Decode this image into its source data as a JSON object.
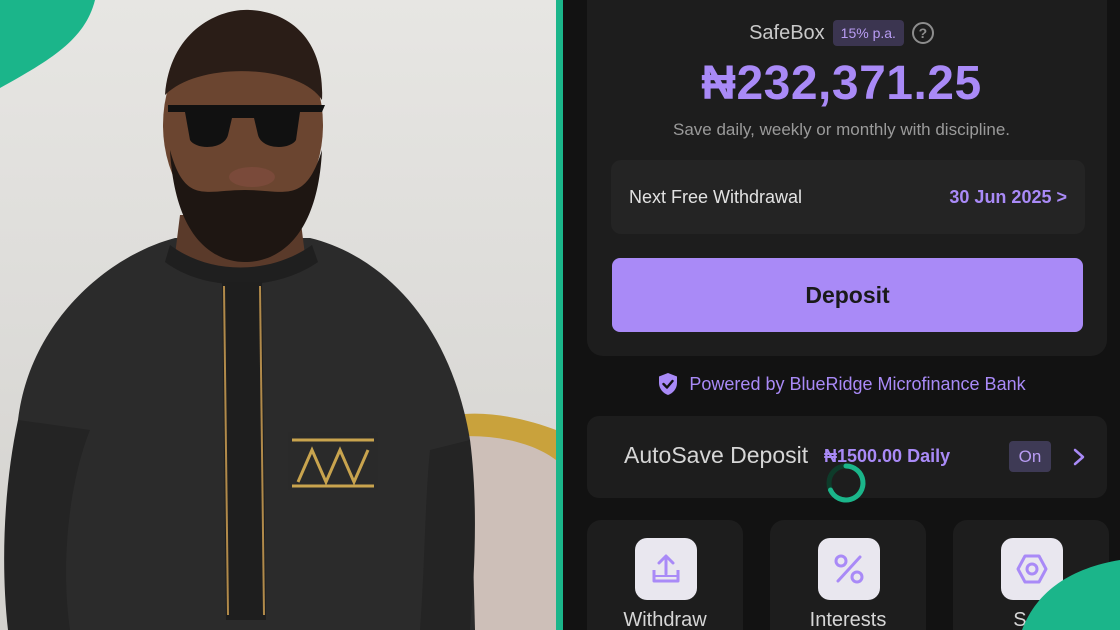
{
  "savings": {
    "title": "SafeBox",
    "rate_badge": "15% p.a.",
    "help_icon": "?",
    "balance": "₦232,371.25",
    "tagline": "Save daily, weekly or monthly with discipline."
  },
  "withdrawal": {
    "label": "Next Free Withdrawal",
    "date": "30 Jun 2025 >"
  },
  "deposit_button": "Deposit",
  "powered_by": "Powered by BlueRidge Microfinance Bank",
  "autosave": {
    "title": "AutoSave Deposit",
    "amount": "₦1500.00 Daily",
    "status": "On"
  },
  "actions": [
    {
      "label": "Withdraw",
      "icon": "upload-tray-icon"
    },
    {
      "label": "Interests",
      "icon": "percent-icon"
    },
    {
      "label": "Sett",
      "icon": "hexagon-gear-icon"
    }
  ],
  "colors": {
    "accent": "#a98af7",
    "background": "#121212",
    "card": "#1d1d1d",
    "brand_green": "#1bb58a"
  }
}
